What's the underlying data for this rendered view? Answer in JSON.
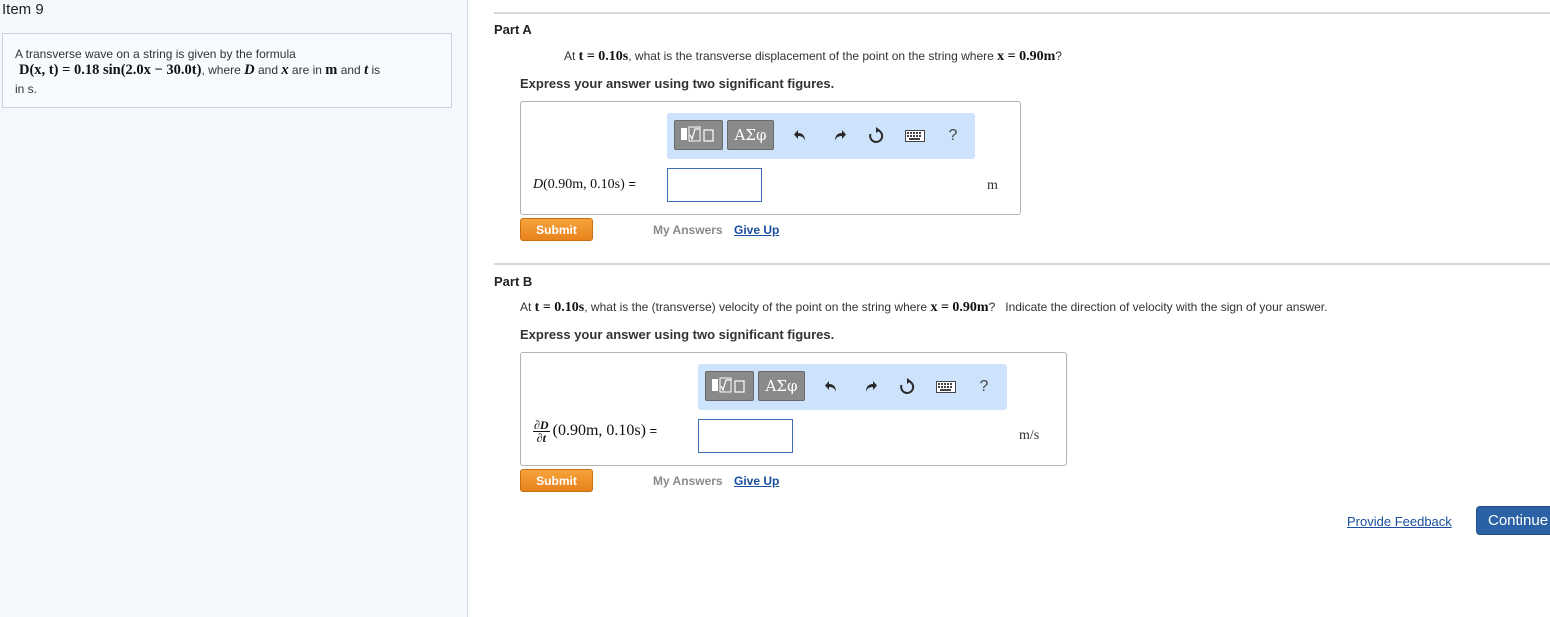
{
  "item": {
    "title": "Item 9"
  },
  "problem": {
    "intro": "A transverse wave on a string is given by the formula",
    "formula": "D(x, t) = 0.18 sin(2.0x − 30.0t)",
    "where_text": ", where ",
    "var_D": "D",
    "and_text": " and ",
    "var_x": "x",
    "are_in": " are in ",
    "unit_m": "m",
    "and_t_text": " and ",
    "var_t": "t",
    "is_text": " is",
    "line3": "in s."
  },
  "toolbar": {
    "templates_icon": "templates-icon",
    "symbols_label": "ΑΣφ",
    "undo_icon": "undo-icon",
    "redo_icon": "redo-icon",
    "reset_icon": "reset-icon",
    "keyboard_icon": "keyboard-icon",
    "help_label": "?"
  },
  "part_a": {
    "label": "Part A",
    "q_prefix": "At ",
    "q_t": "t = 0.10s",
    "q_mid": ", what is the transverse displacement of the point on the string where ",
    "q_x": "x = 0.90m",
    "q_suffix": "?",
    "express": "Express your answer using two significant figures.",
    "answer_label_var": "D",
    "answer_label_rest": "(0.90m, 0.10s)",
    "answer_eq": " =",
    "answer_value": "",
    "units": "m",
    "submit": "Submit",
    "my_answers": "My Answers",
    "give_up": "Give Up"
  },
  "part_b": {
    "label": "Part B",
    "q_prefix": "At ",
    "q_t": "t = 0.10s",
    "q_mid": ", what is the (transverse) velocity of the point on the string where ",
    "q_x": "x = 0.90m",
    "q_suffix": "?   Indicate the direction of velocity with the sign of your answer.",
    "express": "Express your answer using two significant figures.",
    "frac_num": "∂D",
    "frac_den": "∂t",
    "answer_label_rest": "(0.90m, 0.10s)",
    "answer_eq": " =",
    "answer_value": "",
    "units": "m/s",
    "submit": "Submit",
    "my_answers": "My Answers",
    "give_up": "Give Up"
  },
  "footer": {
    "provide_feedback": "Provide Feedback",
    "continue": "Continue"
  }
}
